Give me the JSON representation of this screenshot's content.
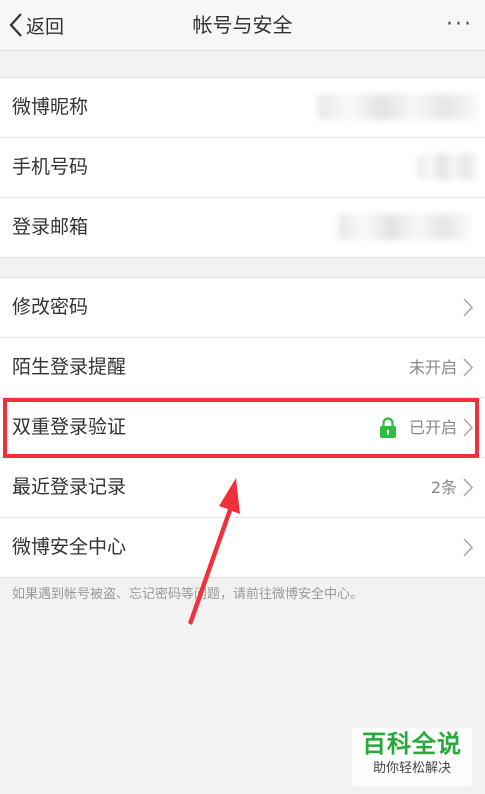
{
  "nav": {
    "back_label": "返回",
    "title": "帐号与安全",
    "more": "···"
  },
  "group1": [
    {
      "label": "微博昵称"
    },
    {
      "label": "手机号码"
    },
    {
      "label": "登录邮箱"
    }
  ],
  "group2": [
    {
      "label": "修改密码",
      "value": ""
    },
    {
      "label": "陌生登录提醒",
      "value": "未开启"
    },
    {
      "label": "双重登录验证",
      "value": "已开启"
    },
    {
      "label": "最近登录记录",
      "value": "2条"
    },
    {
      "label": "微博安全中心",
      "value": ""
    }
  ],
  "footnote": "如果遇到帐号被盗、忘记密码等问题，请前往微博安全中心。",
  "watermark": {
    "title": "百科全说",
    "subtitle": "助你轻松解决"
  },
  "colors": {
    "highlight": "#f0313b",
    "lock": "#2dbd3f",
    "watermark": "#27a83a"
  }
}
